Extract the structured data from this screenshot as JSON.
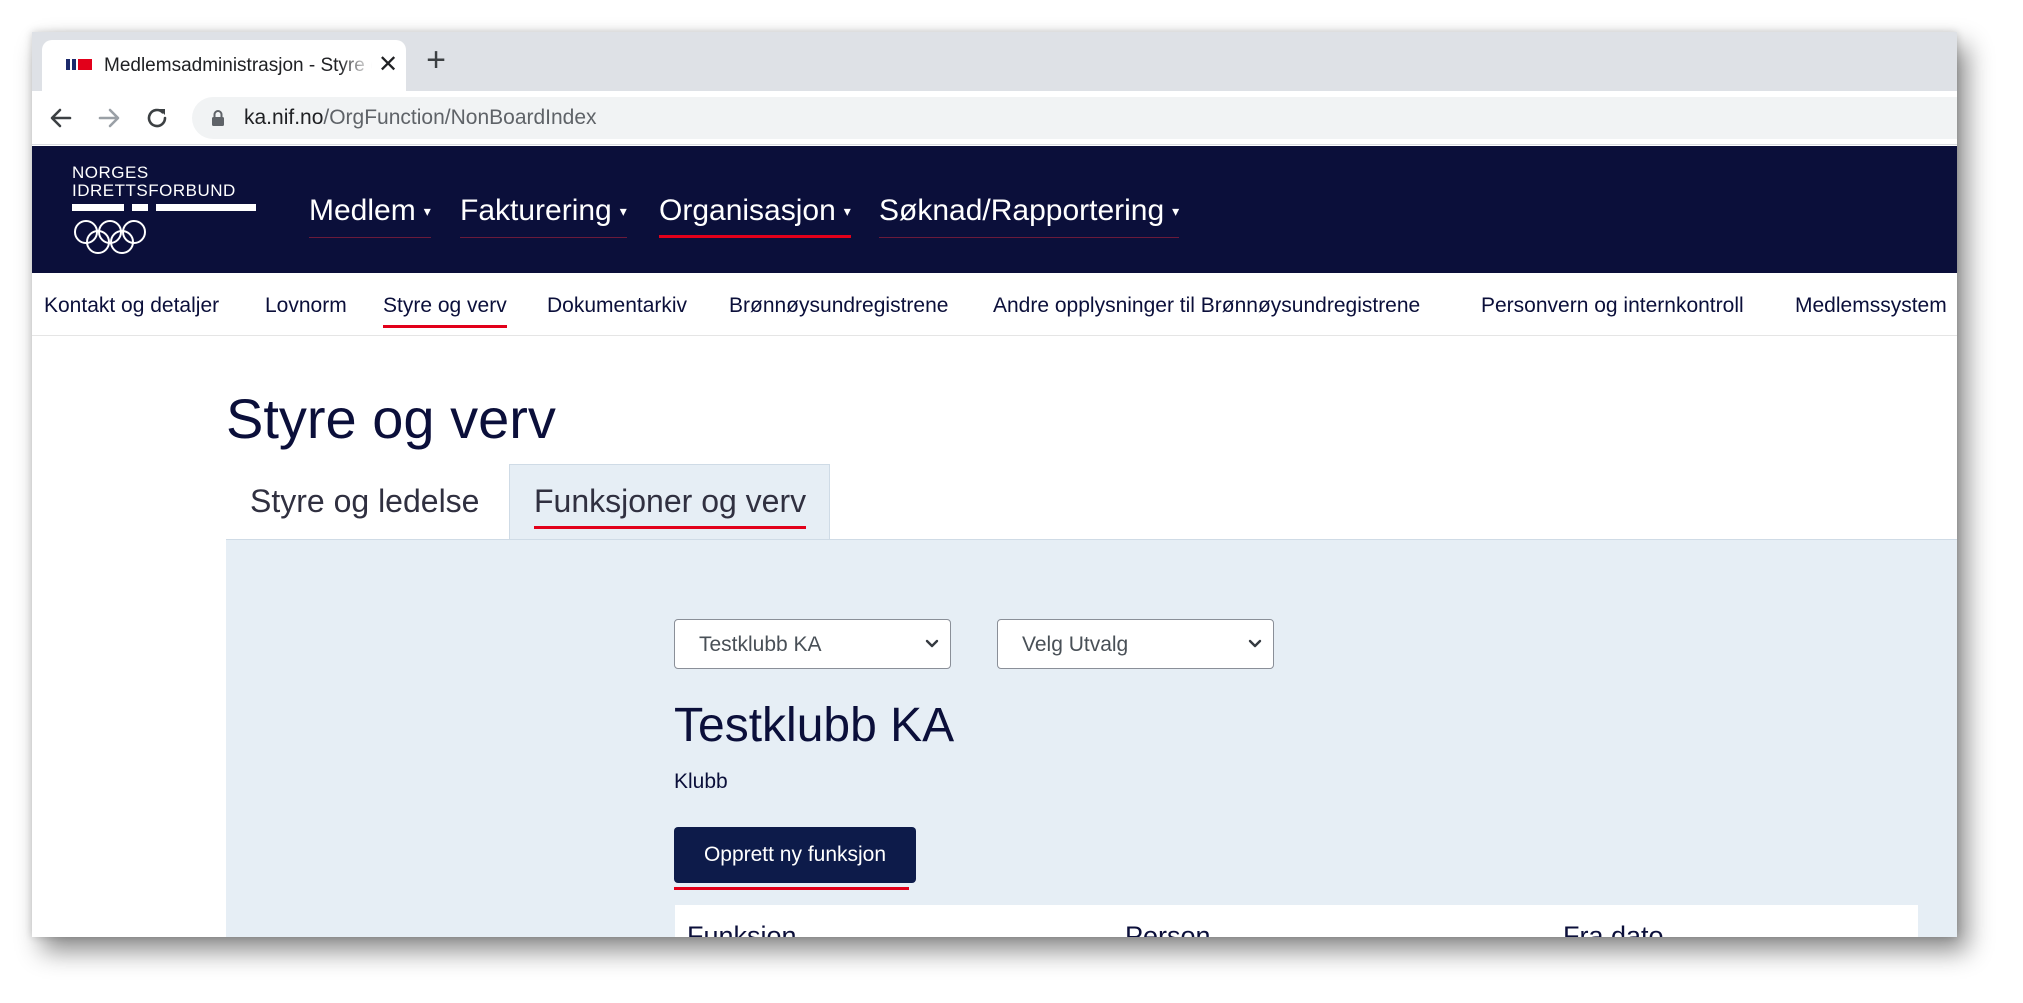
{
  "browser": {
    "tab_title": "Medlemsadministrasjon - Styre og verv",
    "close_glyph": "✕",
    "new_tab_glyph": "+",
    "url_host": "ka.nif.no",
    "url_path": "/OrgFunction/NonBoardIndex"
  },
  "logo": {
    "line1": "NORGES",
    "line2": "IDRETTSFORBUND"
  },
  "main_nav": {
    "items": [
      {
        "label": "Medlem",
        "active": false
      },
      {
        "label": "Fakturering",
        "active": false
      },
      {
        "label": "Organisasjon",
        "active": true
      },
      {
        "label": "Søknad/Rapportering",
        "active": false
      }
    ],
    "caret": "▾"
  },
  "sub_nav": {
    "items": [
      {
        "label": "Kontakt og detaljer",
        "active": false
      },
      {
        "label": "Lovnorm",
        "active": false
      },
      {
        "label": "Styre og verv",
        "active": true
      },
      {
        "label": "Dokumentarkiv",
        "active": false
      },
      {
        "label": "Brønnøysundregistrene",
        "active": false
      },
      {
        "label": "Andre opplysninger til Brønnøysundregistrene",
        "active": false
      },
      {
        "label": "Personvern og internkontroll",
        "active": false
      },
      {
        "label": "Medlemssystem",
        "active": false
      }
    ]
  },
  "page": {
    "title": "Styre og verv",
    "tabs": [
      {
        "label": "Styre og ledelse",
        "active": false
      },
      {
        "label": "Funksjoner og verv",
        "active": true
      }
    ]
  },
  "filters": {
    "org_select_value": "Testklubb KA",
    "committee_select_value": "Velg Utvalg"
  },
  "org": {
    "name": "Testklubb KA",
    "type": "Klubb"
  },
  "actions": {
    "create_function_label": "Opprett ny funksjon"
  },
  "table": {
    "headers": [
      "Funksjon",
      "Person",
      "Fra dato"
    ]
  },
  "colors": {
    "header_bg": "#0b0f3a",
    "accent_red": "#e2001a",
    "panel_bg": "#e6eef5",
    "button_bg": "#0d1b4a"
  }
}
